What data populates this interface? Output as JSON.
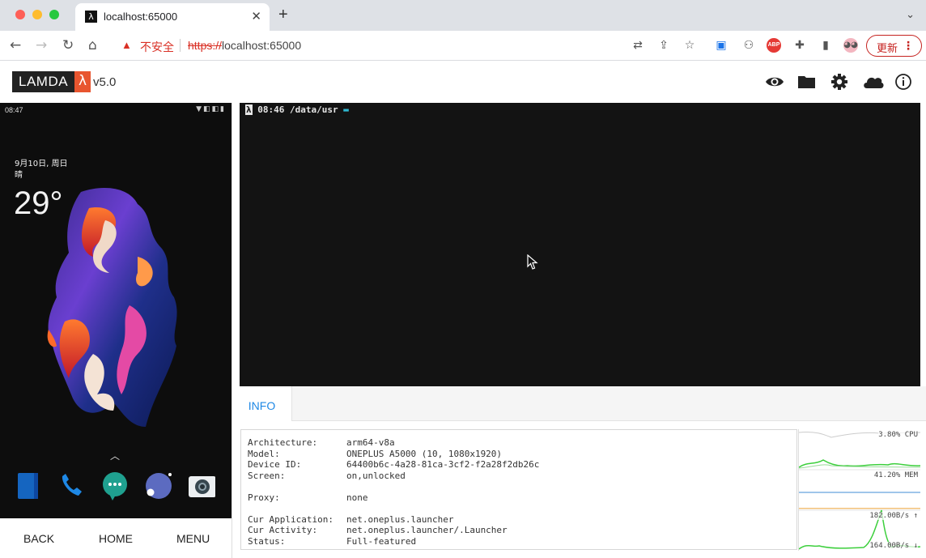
{
  "browser": {
    "tab_title": "localhost:65000",
    "favicon_glyph": "λ",
    "insecure_label": "不安全",
    "url_scheme": "https://",
    "url_host": "localhost:65000",
    "update_label": "更新"
  },
  "app": {
    "logo_text": "LAMDA",
    "logo_lambda": "λ",
    "version": "v5.0",
    "header_icons": [
      "eye-icon",
      "folder-icon",
      "gear-icon",
      "cloud-icon",
      "info-icon"
    ],
    "accent_color": "#1e88e5",
    "brand_color": "#e8552f"
  },
  "phone": {
    "status_time": "08:47",
    "date_line": "9月10日, 周日",
    "weather_line": "晴",
    "temperature": "29°",
    "dock_apps": [
      "notes-app-icon",
      "phone-app-icon",
      "messages-app-icon",
      "browser-app-icon",
      "camera-app-icon"
    ],
    "nav_back": "BACK",
    "nav_home": "HOME",
    "nav_menu": "MENU"
  },
  "terminal": {
    "prompt_time": "08:46",
    "prompt_path": "/data/usr"
  },
  "tabs": {
    "info": "INFO"
  },
  "info": {
    "architecture_label": "Architecture:",
    "architecture": "arm64-v8a",
    "model_label": "Model:",
    "model": "ONEPLUS A5000 (10, 1080x1920)",
    "device_id_label": "Device ID:",
    "device_id": "64400b6c-4a28-81ca-3cf2-f2a28f2db26c",
    "screen_label": "Screen:",
    "screen": "on,unlocked",
    "proxy_label": "Proxy:",
    "proxy": "none",
    "cur_app_label": "Cur Application:",
    "cur_app": "net.oneplus.launcher",
    "cur_activity_label": "Cur Activity:",
    "cur_activity": "net.oneplus.launcher/.Launcher",
    "status_label": "Status:",
    "status": "Full-featured"
  },
  "monitor": {
    "cpu_label": "3.80% CPU",
    "mem_label": "41.20% MEM",
    "net_up_label": "182.00B/s ↑",
    "net_down_label": "164.00B/s ↓"
  }
}
